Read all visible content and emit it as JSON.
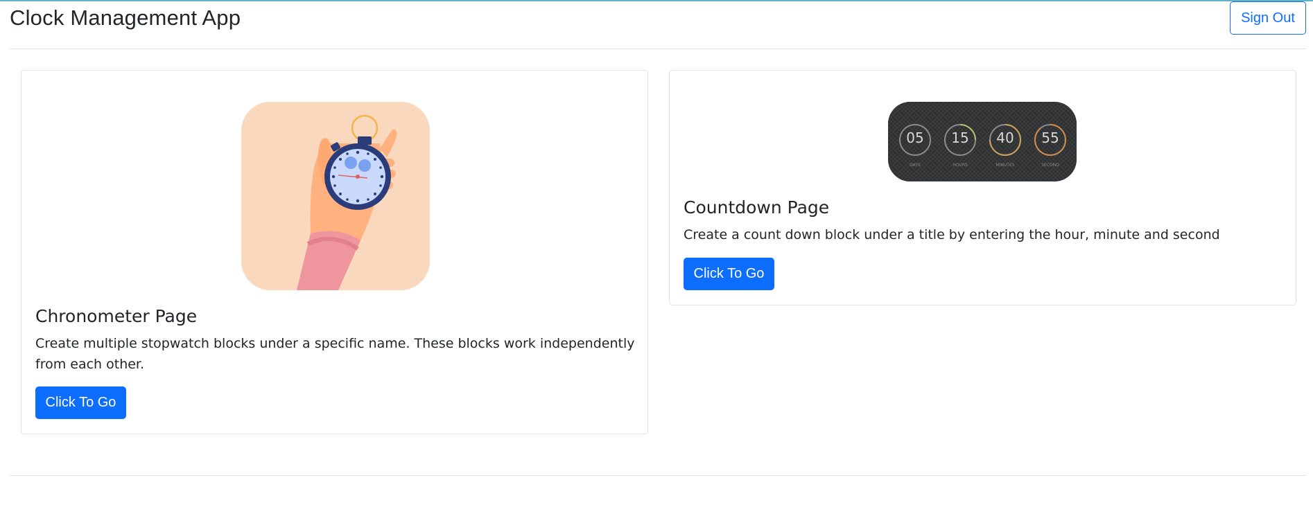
{
  "header": {
    "title": "Clock Management App",
    "sign_out_label": "Sign Out"
  },
  "cards": [
    {
      "title": "Chronometer Page",
      "description": "Create multiple stopwatch blocks under a specific name. These blocks work independently from each other.",
      "button_label": "Click To Go",
      "image_icon": "stopwatch-in-hand-illustration"
    },
    {
      "title": "Countdown Page",
      "description": "Create a count down block under a title by entering the hour, minute and second",
      "button_label": "Click To Go",
      "image_icon": "countdown-timer-illustration",
      "countdown": [
        {
          "value": "05",
          "unit": "DAYS"
        },
        {
          "value": "15",
          "unit": "HOURS"
        },
        {
          "value": "40",
          "unit": "MINUTES"
        },
        {
          "value": "55",
          "unit": "SECOND"
        }
      ]
    }
  ],
  "colors": {
    "primary": "#0d6efd",
    "border": "#dee2e6",
    "accent_top": "#5fb3c4",
    "chronometer_bg": "#fad8bd",
    "countdown_bg": "#303133"
  }
}
